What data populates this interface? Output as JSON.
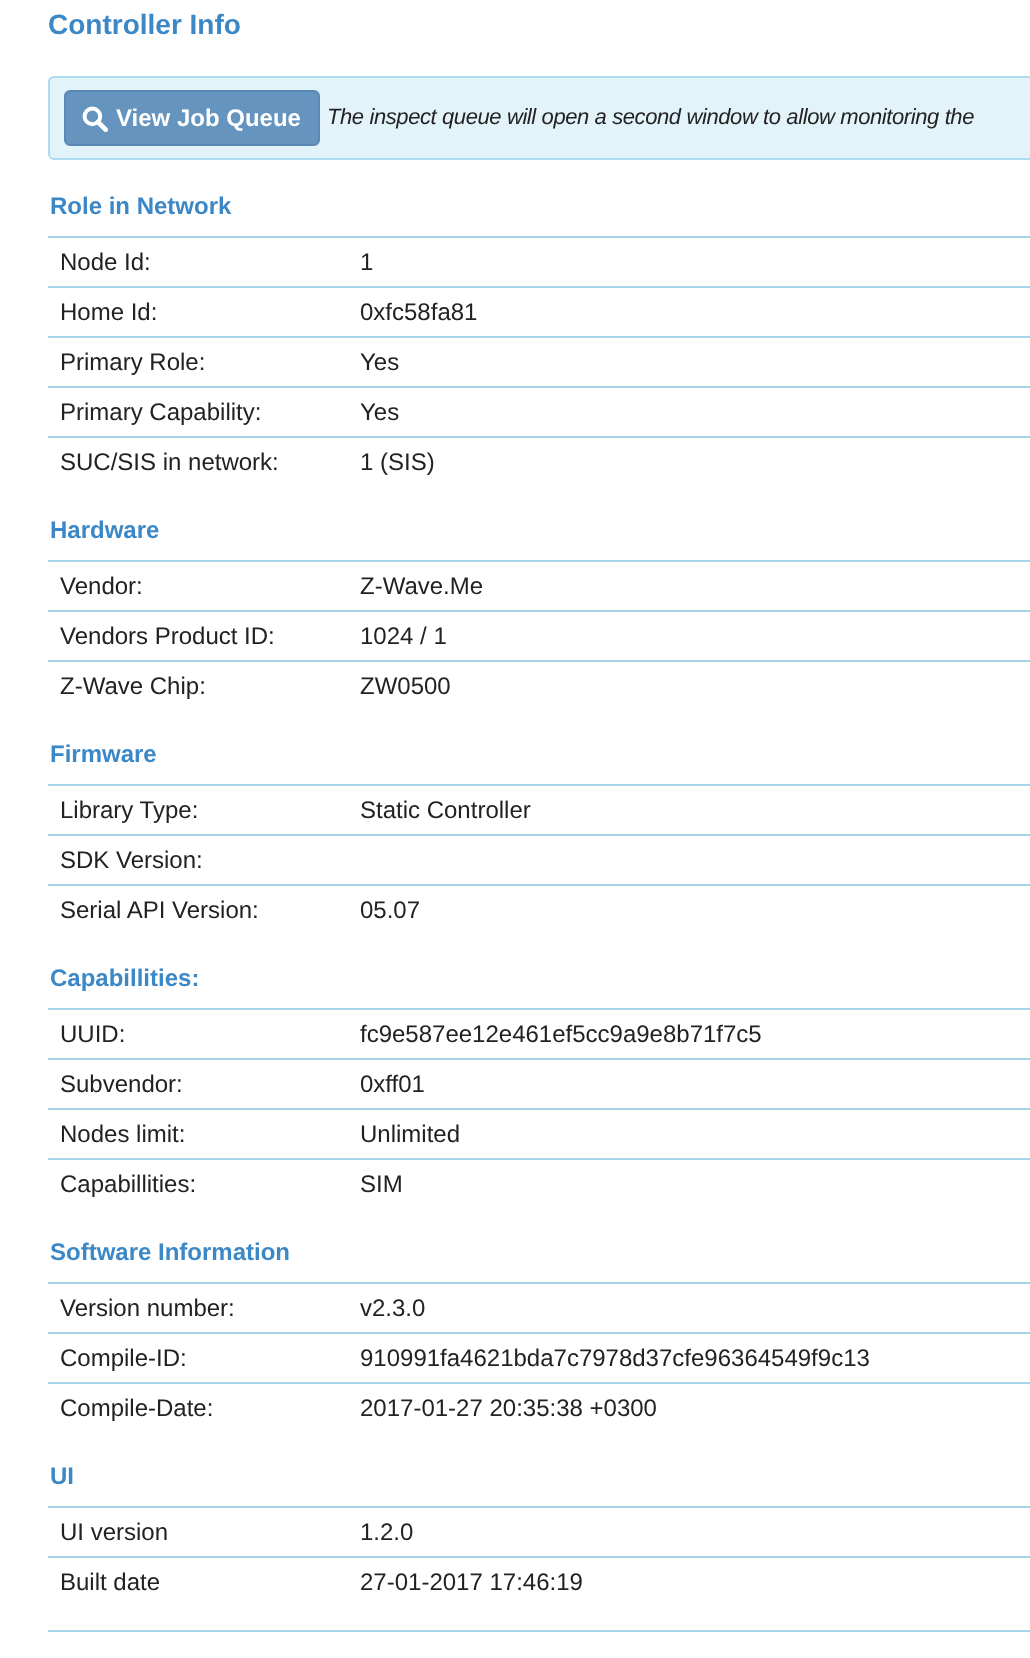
{
  "title": "Controller Info",
  "notice": {
    "button": "View Job Queue",
    "text": "The inspect queue will open a second window to allow monitoring the"
  },
  "sections": [
    {
      "heading": "Role in Network",
      "rows": [
        {
          "label": "Node Id:",
          "value": "1"
        },
        {
          "label": "Home Id:",
          "value": "0xfc58fa81"
        },
        {
          "label": "Primary Role:",
          "value": "Yes"
        },
        {
          "label": "Primary Capability:",
          "value": "Yes"
        },
        {
          "label": "SUC/SIS in network:",
          "value": "1 (SIS)"
        }
      ]
    },
    {
      "heading": "Hardware",
      "rows": [
        {
          "label": "Vendor:",
          "value": "Z-Wave.Me"
        },
        {
          "label": "Vendors Product ID:",
          "value": "1024 / 1"
        },
        {
          "label": "Z-Wave Chip:",
          "value": "ZW0500"
        }
      ]
    },
    {
      "heading": "Firmware",
      "rows": [
        {
          "label": "Library Type:",
          "value": "Static Controller"
        },
        {
          "label": "SDK Version:"
        },
        {
          "label": "Serial API Version:",
          "value": "05.07"
        }
      ]
    },
    {
      "heading": "Capabillities:",
      "rows": [
        {
          "label": "UUID:",
          "value": "fc9e587ee12e461ef5cc9a9e8b71f7c5"
        },
        {
          "label": "Subvendor:",
          "value": "0xff01"
        },
        {
          "label": "Nodes limit:",
          "value": "Unlimited"
        },
        {
          "label": "Capabillities:",
          "value": "SIM"
        }
      ]
    },
    {
      "heading": "Software Information",
      "rows": [
        {
          "label": "Version number:",
          "value": "v2.3.0"
        },
        {
          "label": "Compile-ID:",
          "value": "910991fa4621bda7c7978d37cfe96364549f9c13"
        },
        {
          "label": "Compile-Date:",
          "value": "2017-01-27 20:35:38 +0300"
        }
      ]
    },
    {
      "heading": "UI",
      "rows": [
        {
          "label": "UI version",
          "value": "1.2.0"
        },
        {
          "label": "Built date",
          "value": "27-01-2017 17:46:19"
        }
      ]
    }
  ]
}
